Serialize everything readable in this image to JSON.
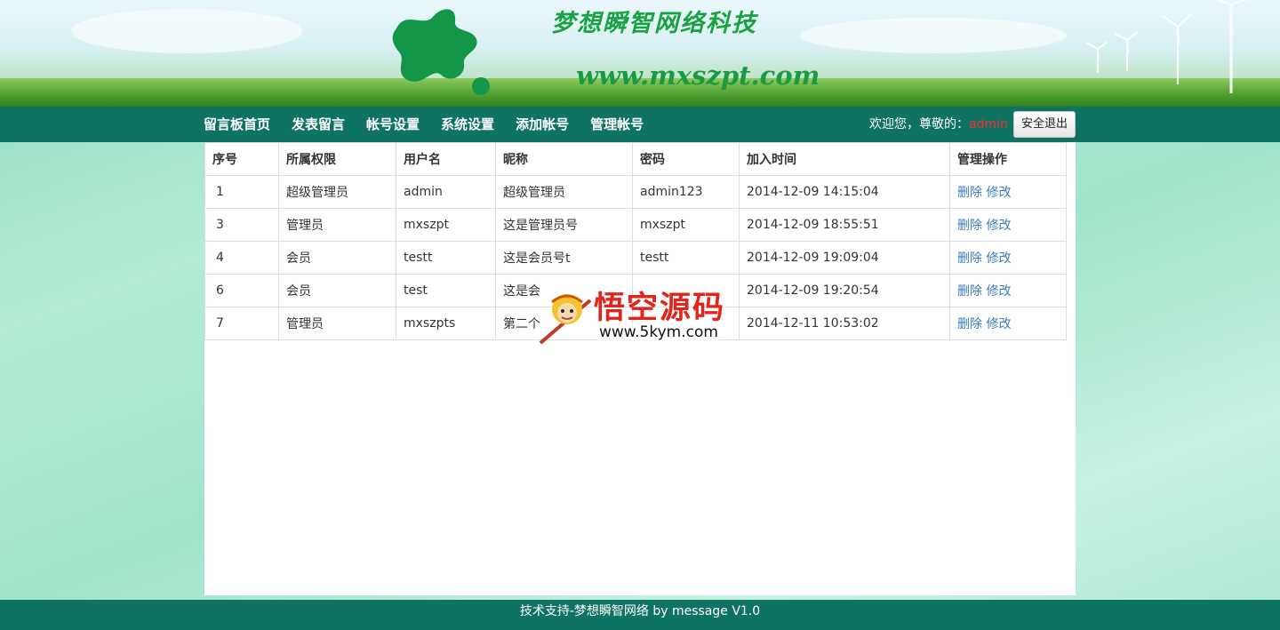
{
  "header": {
    "site_title": "梦想瞬智网络科技",
    "site_url": "www.mxszpt.com"
  },
  "nav": {
    "items": [
      {
        "label": "留言板首页"
      },
      {
        "label": "发表留言"
      },
      {
        "label": "帐号设置"
      },
      {
        "label": "系统设置"
      },
      {
        "label": "添加帐号"
      },
      {
        "label": "管理帐号"
      }
    ],
    "welcome_prefix": "欢迎您，尊敬的：",
    "username": "admin",
    "logout_label": "安全退出"
  },
  "table": {
    "headers": [
      "序号",
      "所属权限",
      "用户名",
      "昵称",
      "密码",
      "加入时间",
      "管理操作"
    ],
    "rows": [
      {
        "id": "1",
        "role": "超级管理员",
        "username": "admin",
        "nickname": "超级管理员",
        "password": "admin123",
        "joined": "2014-12-09 14:15:04"
      },
      {
        "id": "3",
        "role": "管理员",
        "username": "mxszpt",
        "nickname": "这是管理员号",
        "password": "mxszpt",
        "joined": "2014-12-09 18:55:51"
      },
      {
        "id": "4",
        "role": "会员",
        "username": "testt",
        "nickname": "这是会员号t",
        "password": "testt",
        "joined": "2014-12-09 19:09:04"
      },
      {
        "id": "6",
        "role": "会员",
        "username": "test",
        "nickname": "这是会",
        "password": "",
        "joined": "2014-12-09 19:20:54"
      },
      {
        "id": "7",
        "role": "管理员",
        "username": "mxszpts",
        "nickname": "第二个",
        "password": "",
        "joined": "2014-12-11 10:53:02"
      }
    ],
    "delete_label": "删除",
    "edit_label": "修改"
  },
  "watermark": {
    "text": "悟空源码",
    "url": "www.5kym.com"
  },
  "footer": {
    "text": "技术支持-梦想瞬智网络 by message V1.0"
  },
  "colors": {
    "nav_bg": "#0f7363",
    "link": "#3a7cb8",
    "username": "#ff2a2a",
    "title_green": "#1aa148"
  }
}
